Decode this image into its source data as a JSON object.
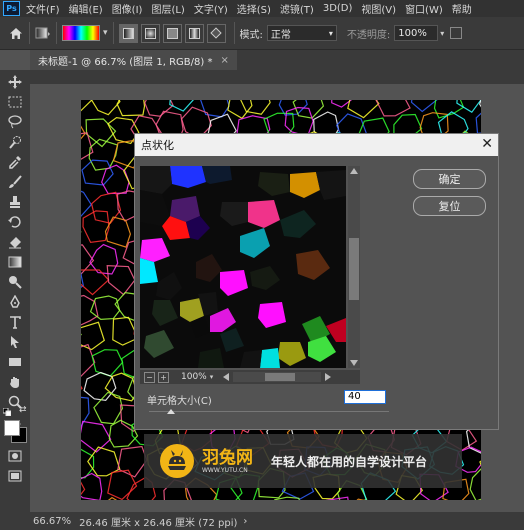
{
  "app": {
    "logo_text": "Ps",
    "menu": [
      "文件(F)",
      "编辑(E)",
      "图像(I)",
      "图层(L)",
      "文字(Y)",
      "选择(S)",
      "滤镜(T)",
      "3D(D)",
      "视图(V)",
      "窗口(W)",
      "帮助"
    ]
  },
  "options": {
    "mode_label": "模式:",
    "mode_value": "正常",
    "opacity_label": "不透明度:",
    "opacity_value": "100%"
  },
  "document": {
    "tab_title": "未标题-1 @ 66.7% (图层 1, RGB/8) *",
    "tab_close": "×"
  },
  "status": {
    "zoom": "66.67%",
    "info": "26.46 厘米 x 26.46 厘米 (72 ppi)",
    "arrow": "›"
  },
  "dialog": {
    "title": "点状化",
    "close": "✕",
    "ok_label": "确定",
    "reset_label": "复位",
    "zoom_value": "100%",
    "zoom_out": "−",
    "zoom_in": "+",
    "cell_size_label": "单元格大小(C)",
    "cell_size_value": "40",
    "cell_size_fraction": 0.09
  },
  "watermark": {
    "brand": "羽兔网",
    "url": "WWW.YUTU.CN",
    "slogan": "年轻人都在用的自学设计平台"
  },
  "colors": {
    "accent": "#1e6fd9",
    "brand": "#f2b516"
  }
}
